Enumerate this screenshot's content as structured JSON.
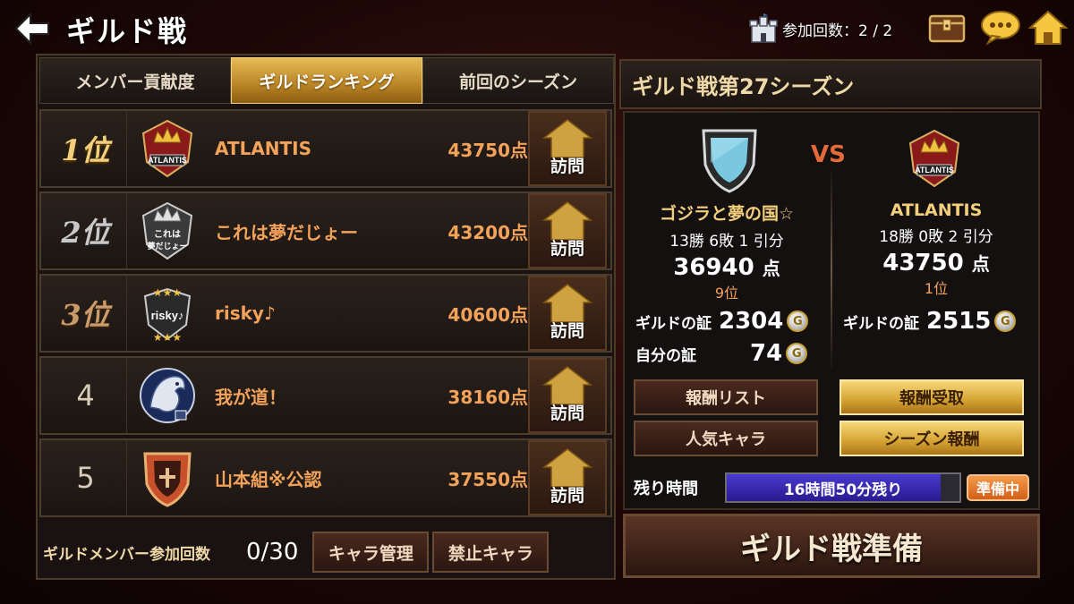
{
  "header": {
    "title": "ギルド戦",
    "participation_label": "参加回数：2 / 2"
  },
  "tabs": [
    {
      "label": "メンバー貢献度"
    },
    {
      "label": "ギルドランキング"
    },
    {
      "label": "前回のシーズン"
    }
  ],
  "ranking": [
    {
      "rank": "1位",
      "name": "ATLANTIS",
      "score": "43750点",
      "visit": "訪問"
    },
    {
      "rank": "2位",
      "name": "これは夢だじょー",
      "score": "43200点",
      "visit": "訪問"
    },
    {
      "rank": "3位",
      "name": "risky♪",
      "score": "40600点",
      "visit": "訪問"
    },
    {
      "rank": "4",
      "name": "我が道！",
      "score": "38160点",
      "visit": "訪問"
    },
    {
      "rank": "5",
      "name": "山本組※公認",
      "score": "37550点",
      "visit": "訪問"
    }
  ],
  "emblem_text": {
    "atlantis": "ATLANTIS",
    "yume": "これは\n夢だじょー",
    "risky": "risky♪"
  },
  "bottom": {
    "member_label": "ギルドメンバー参加回数",
    "member_count": "0/30",
    "chara_manage": "キャラ管理",
    "banned_chara": "禁止キャラ"
  },
  "season": {
    "title": "ギルド戦第27シーズン",
    "vs": "VS",
    "mine": {
      "name": "ゴジラと夢の国☆",
      "record": "13勝 6敗 1 引分",
      "score": "36940",
      "score_unit": "点",
      "rank": "9位",
      "guild_proof_label": "ギルドの証",
      "guild_proof": "2304",
      "self_proof_label": "自分の証",
      "self_proof": "74"
    },
    "opponent": {
      "name": "ATLANTIS",
      "record": "18勝 0敗 2 引分",
      "score": "43750",
      "score_unit": "点",
      "rank": "1位",
      "guild_proof_label": "ギルドの証",
      "guild_proof": "2515"
    },
    "coin_glyph": "G"
  },
  "buttons": {
    "reward_list": "報酬リスト",
    "reward_receive": "報酬受取",
    "popular_chara": "人気キャラ",
    "season_reward": "シーズン報酬"
  },
  "remaining": {
    "label": "残り時間",
    "text": "16時間50分残り",
    "progress": 0.92,
    "status": "準備中"
  },
  "main_action": "ギルド戦準備",
  "colors": {
    "accent_gold": "#f3cf7c",
    "score_orange": "#f3a25a",
    "vs_red": "#e56a3a"
  }
}
